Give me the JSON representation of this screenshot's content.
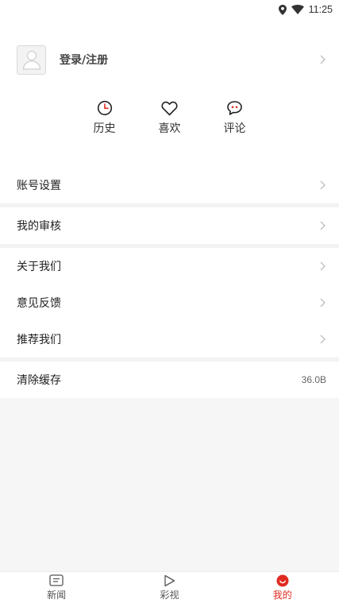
{
  "status_bar": {
    "time": "11:25",
    "icons": [
      "location-icon",
      "wifi-icon"
    ]
  },
  "profile": {
    "avatar_icon": "user-placeholder-icon",
    "login_label": "登录/注册"
  },
  "quick_actions": [
    {
      "icon": "clock-icon",
      "label": "历史"
    },
    {
      "icon": "heart-icon",
      "label": "喜欢"
    },
    {
      "icon": "comment-icon",
      "label": "评论"
    }
  ],
  "menu": {
    "account_settings": "账号设置",
    "my_review": "我的审核",
    "about_us": "关于我们",
    "feedback": "意见反馈",
    "recommend_us": "推荐我们",
    "clear_cache": "清除缓存",
    "cache_size": "36.0B"
  },
  "bottom_nav": [
    {
      "icon": "news-icon",
      "label": "新闻"
    },
    {
      "icon": "play-icon",
      "label": "彩视"
    },
    {
      "icon": "profile-icon",
      "label": "我的",
      "active": true
    }
  ],
  "colors": {
    "accent": "#e02b20",
    "background": "#f6f6f6",
    "card": "#ffffff"
  }
}
